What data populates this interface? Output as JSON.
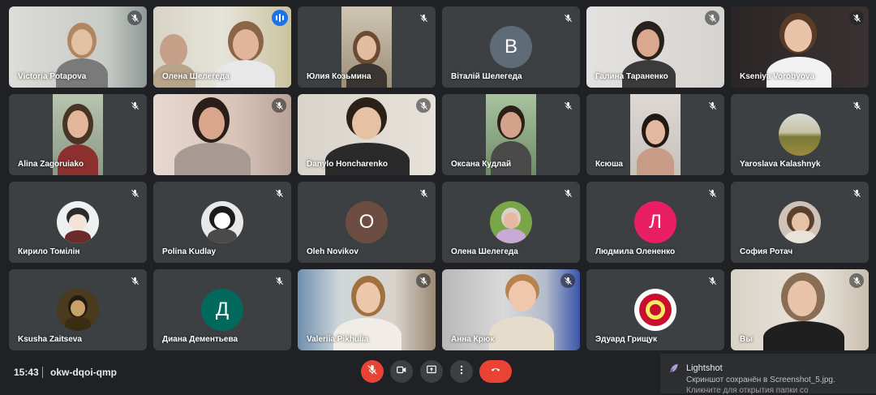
{
  "participants": [
    {
      "name": "Victoria Potapova",
      "muted": true
    },
    {
      "name": "Олена Шелегеда",
      "muted": false,
      "speaking": true
    },
    {
      "name": "Юлия Козьмина",
      "muted": true
    },
    {
      "name": "Віталій Шелегеда",
      "muted": true,
      "initial": "В"
    },
    {
      "name": "Галина Тараненко",
      "muted": true
    },
    {
      "name": "Kseniya Vorobyova",
      "muted": true
    },
    {
      "name": "Alina Zagoruiako",
      "muted": true
    },
    {
      "name": "",
      "muted": true
    },
    {
      "name": "Danylo Honcharenko",
      "muted": true
    },
    {
      "name": "Оксана Кудлай",
      "muted": true
    },
    {
      "name": "Ксюша",
      "muted": true
    },
    {
      "name": "Yaroslava Kalashnyk",
      "muted": true
    },
    {
      "name": "Кирило Томілін",
      "muted": true
    },
    {
      "name": "Polina Kudlay",
      "muted": true
    },
    {
      "name": "Oleh Novikov",
      "muted": true,
      "initial": "O"
    },
    {
      "name": "Олена Шелегеда",
      "muted": true
    },
    {
      "name": "Людмила Олененко",
      "muted": true,
      "initial": "Л"
    },
    {
      "name": "София Ротач",
      "muted": true
    },
    {
      "name": "Ksusha Zaitseva",
      "muted": true
    },
    {
      "name": "Диана Дементьева",
      "muted": true,
      "initial": "Д"
    },
    {
      "name": "Valeriia Pikhulia",
      "muted": true
    },
    {
      "name": "Анна Крюк",
      "muted": true
    },
    {
      "name": "Эдуард Грищук",
      "muted": true
    },
    {
      "name": "Вы",
      "muted": true
    }
  ],
  "bottom_bar": {
    "time": "15:43",
    "meeting_code": "okw-dqoi-qmp",
    "controls": [
      "mic-off-icon",
      "camera-icon",
      "present-screen-icon",
      "more-options-icon",
      "end-call-icon"
    ]
  },
  "toast": {
    "title": "Lightshot",
    "line1": "Скриншот сохранён в Screenshot_5.jpg.",
    "line2": "Кликните для открытия папки со"
  },
  "colors": {
    "background": "#202124",
    "tile": "#3c4043",
    "speaking": "#1a73e8",
    "end_call": "#ea4335",
    "avatar_v": "#5f6b77",
    "avatar_o": "#6d4c41",
    "avatar_l": "#e91e63",
    "avatar_d": "#00695c"
  }
}
